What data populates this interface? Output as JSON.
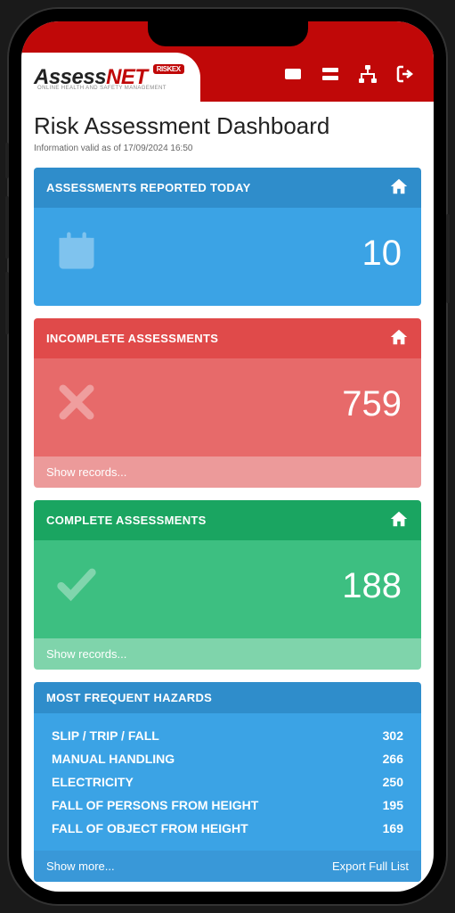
{
  "header": {
    "logo_prefix": "Assess",
    "logo_suffix": "NET",
    "logo_badge": "RISKEX",
    "logo_tagline": "ONLINE HEALTH AND SAFETY MANAGEMENT"
  },
  "page": {
    "title": "Risk Assessment Dashboard",
    "subtitle": "Information valid as of 17/09/2024 16:50"
  },
  "cards": {
    "reported": {
      "title": "ASSESSMENTS REPORTED TODAY",
      "value": "10"
    },
    "incomplete": {
      "title": "INCOMPLETE ASSESSMENTS",
      "value": "759",
      "footer": "Show records..."
    },
    "complete": {
      "title": "COMPLETE ASSESSMENTS",
      "value": "188",
      "footer": "Show records..."
    },
    "hazards": {
      "title": "MOST FREQUENT HAZARDS",
      "rows": [
        {
          "label": "SLIP / TRIP / FALL",
          "value": "302"
        },
        {
          "label": "MANUAL HANDLING",
          "value": "266"
        },
        {
          "label": "ELECTRICITY",
          "value": "250"
        },
        {
          "label": "FALL OF PERSONS FROM HEIGHT",
          "value": "195"
        },
        {
          "label": "FALL OF OBJECT FROM HEIGHT",
          "value": "169"
        }
      ],
      "footer_left": "Show more...",
      "footer_right": "Export Full List"
    }
  }
}
